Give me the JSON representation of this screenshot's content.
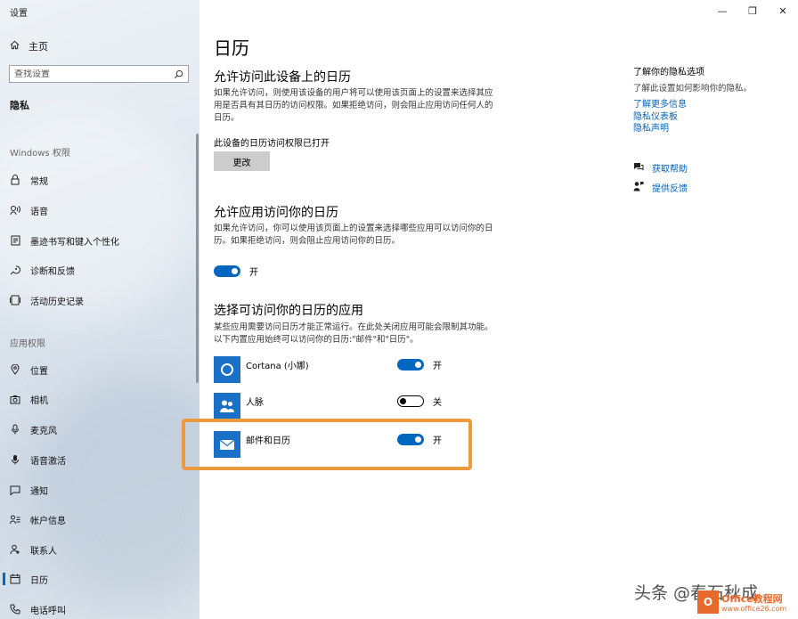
{
  "window": {
    "title": "设置",
    "minimize": "—",
    "restore": "❐",
    "close": "✕"
  },
  "sidebar": {
    "home": "主页",
    "search_placeholder": "查找设置",
    "section": "隐私",
    "group_windows": "Windows 权限",
    "windows_items": [
      {
        "label": "常规",
        "icon": "lock-icon"
      },
      {
        "label": "语音",
        "icon": "speech-icon"
      },
      {
        "label": "墨迹书写和键入个性化",
        "icon": "pen-icon"
      },
      {
        "label": "诊断和反馈",
        "icon": "diagnostics-icon"
      },
      {
        "label": "活动历史记录",
        "icon": "history-icon"
      }
    ],
    "group_apps": "应用权限",
    "app_items": [
      {
        "label": "位置",
        "icon": "location-icon"
      },
      {
        "label": "相机",
        "icon": "camera-icon"
      },
      {
        "label": "麦克风",
        "icon": "microphone-icon"
      },
      {
        "label": "语音激活",
        "icon": "voice-activation-icon"
      },
      {
        "label": "通知",
        "icon": "notification-icon"
      },
      {
        "label": "帐户信息",
        "icon": "account-info-icon"
      },
      {
        "label": "联系人",
        "icon": "contacts-icon"
      },
      {
        "label": "日历",
        "icon": "calendar-icon",
        "active": true
      },
      {
        "label": "电话呼叫",
        "icon": "phone-icon"
      }
    ]
  },
  "main": {
    "title": "日历",
    "device_section": {
      "heading": "允许访问此设备上的日历",
      "description": "如果允许访问，则使用该设备的用户将可以使用该页面上的设置来选择其应用是否具有其日历的访问权限。如果拒绝访问，则会阻止应用访问任何人的日历。",
      "status": "此设备的日历访问权限已打开",
      "button": "更改"
    },
    "apps_access_section": {
      "heading": "允许应用访问你的日历",
      "description": "如果允许访问，你可以使用该页面上的设置来选择哪些应用可以访问你的日历。如果拒绝访问，则会阻止应用访问你的日历。",
      "toggle_label": "开"
    },
    "choose_apps_section": {
      "heading": "选择可访问你的日历的应用",
      "description": "某些应用需要访问日历才能正常运行。在此处关闭应用可能会限制其功能。以下内置应用始终可以访问你的日历:\"邮件\"和\"日历\"。",
      "apps": [
        {
          "name": "Cortana (小娜)",
          "state": "开",
          "on": true
        },
        {
          "name": "人脉",
          "state": "关",
          "on": false
        },
        {
          "name": "邮件和日历",
          "state": "开",
          "on": true
        }
      ]
    }
  },
  "right": {
    "title": "了解你的隐私选项",
    "text": "了解此设置如何影响你的隐私。",
    "links": [
      "了解更多信息",
      "隐私仪表板",
      "隐私声明"
    ],
    "help": "获取帮助",
    "feedback": "提供反馈"
  },
  "watermark": {
    "text": "头条 @春石秋成",
    "logo": "O",
    "brand": "Office教程网",
    "url": "www.office26.com"
  },
  "colors": {
    "accent": "#0067c0",
    "highlight": "#ec9a3c"
  }
}
